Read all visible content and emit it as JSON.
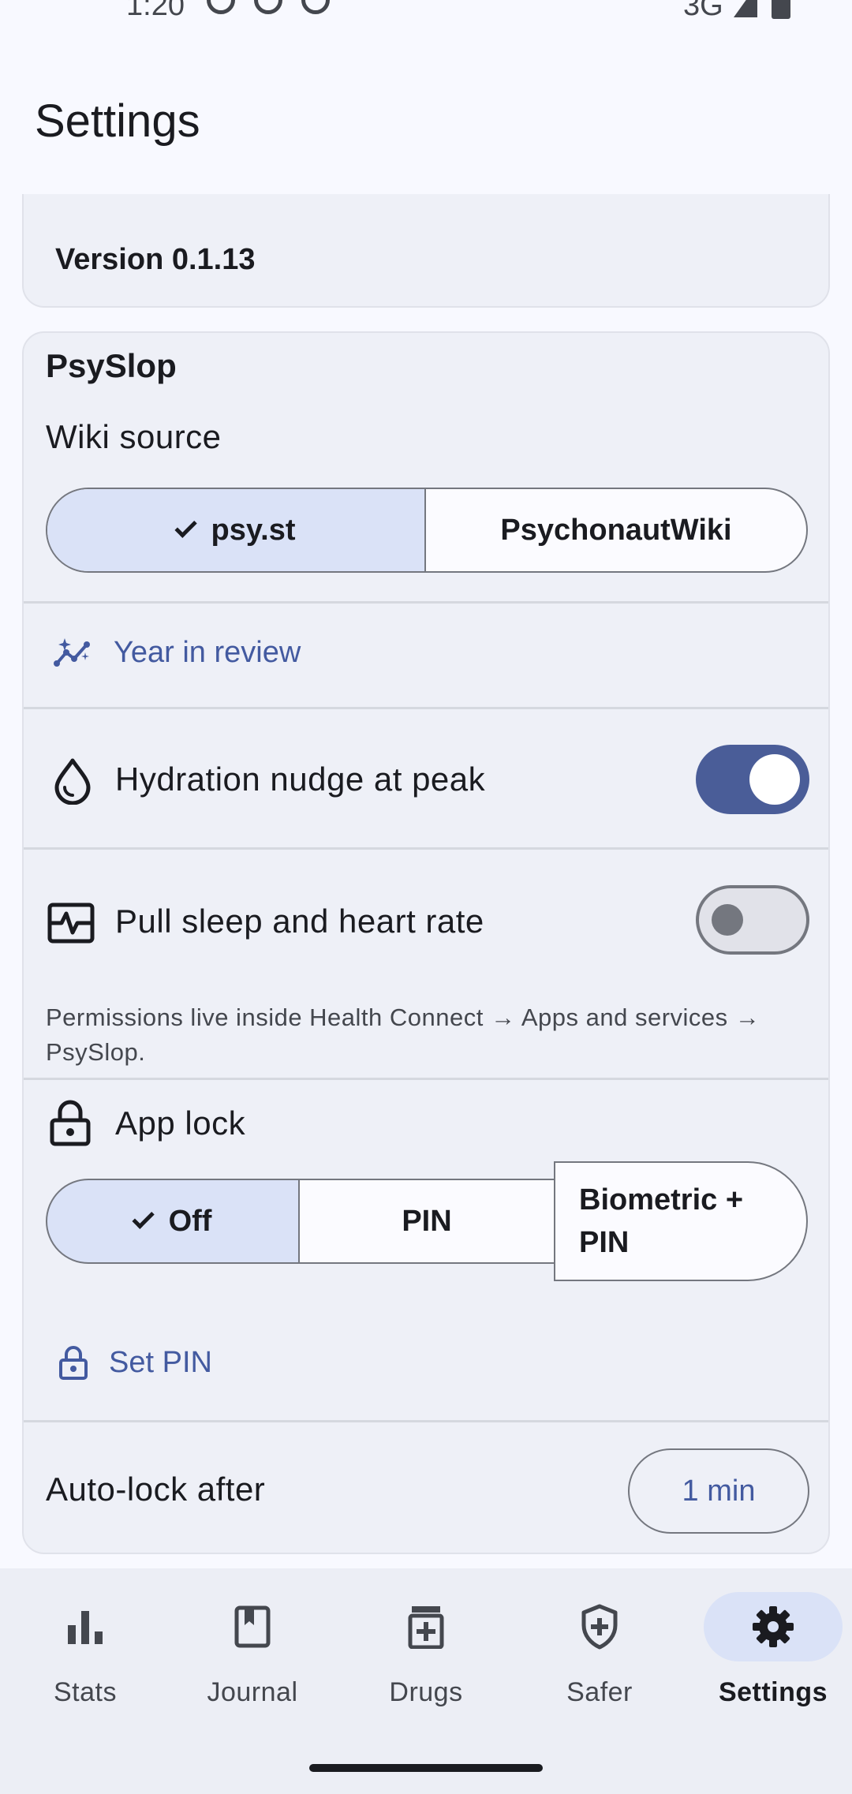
{
  "status": {
    "time": "1:20",
    "network": "3G"
  },
  "app_title": "Settings",
  "version": {
    "text": "Version 0.1.13"
  },
  "psyslop": {
    "title": "PsySlop",
    "wiki_source_label": "Wiki source",
    "wiki_options": [
      {
        "label": "psy.st",
        "selected": true
      },
      {
        "label": "PsychonautWiki",
        "selected": false
      }
    ],
    "year_in_review": "Year in review",
    "hydration": {
      "label": "Hydration nudge at peak",
      "enabled": true
    },
    "health": {
      "label": "Pull sleep and heart rate",
      "enabled": false
    },
    "health_hint": "Permissions live inside Health Connect → Apps and services → PsySlop.",
    "app_lock": {
      "label": "App lock",
      "options": [
        {
          "label": "Off",
          "selected": true
        },
        {
          "label": "PIN",
          "selected": false
        },
        {
          "label": "Biometric + PIN",
          "selected": false
        }
      ],
      "set_pin": "Set PIN"
    },
    "auto_lock": {
      "label": "Auto-lock after",
      "value": "1 min"
    }
  },
  "nav": {
    "items": [
      {
        "label": "Stats",
        "icon": "bar-chart-icon"
      },
      {
        "label": "Journal",
        "icon": "bookmark-book-icon"
      },
      {
        "label": "Drugs",
        "icon": "medication-icon"
      },
      {
        "label": "Safer",
        "icon": "shield-plus-icon"
      },
      {
        "label": "Settings",
        "icon": "gear-icon",
        "active": true
      }
    ]
  },
  "colors": {
    "accent": "#4a5d98",
    "link": "#435aa0",
    "selected_bg": "#dae2f7",
    "surface": "#eef0f7"
  }
}
